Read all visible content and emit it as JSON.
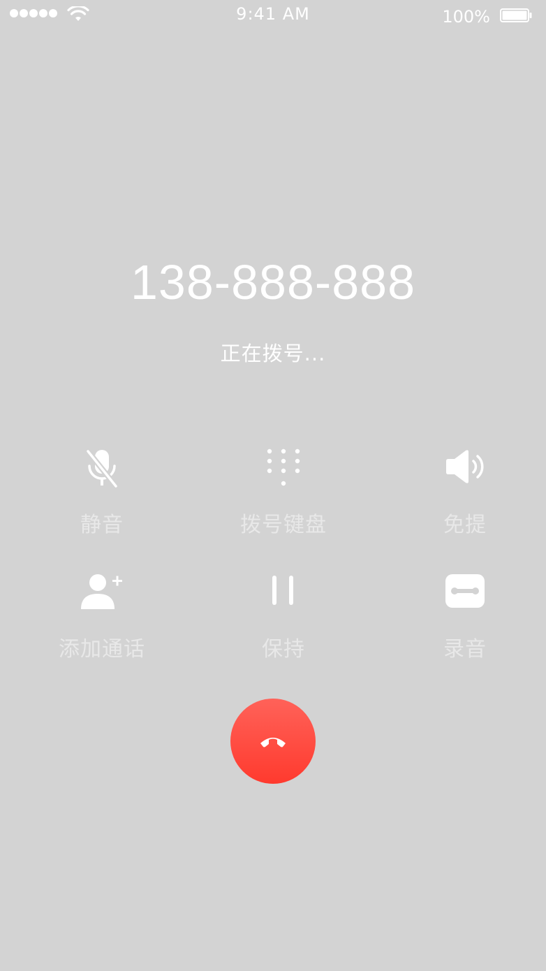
{
  "status_bar": {
    "time": "9:41 AM",
    "battery_percent": "100%",
    "signal_bars": 5,
    "wifi_icon": "wifi-icon",
    "battery_icon": "battery-full-icon"
  },
  "call": {
    "number": "138-888-888",
    "status": "正在拨号..."
  },
  "controls": [
    {
      "label": "静音",
      "icon": "mute-mic-icon"
    },
    {
      "label": "拨号键盘",
      "icon": "keypad-icon"
    },
    {
      "label": "免提",
      "icon": "speaker-icon"
    },
    {
      "label": "添加通话",
      "icon": "add-call-icon"
    },
    {
      "label": "保持",
      "icon": "pause-icon"
    },
    {
      "label": "录音",
      "icon": "record-icon"
    }
  ],
  "end_call": {
    "icon": "end-call-icon",
    "color": "#ff3b30"
  },
  "colors": {
    "background": "#d3d3d3",
    "text": "#ffffff",
    "control_label": "#e8e8e8",
    "end_call_top": "#ff6259",
    "end_call_bottom": "#ff3a2e"
  }
}
